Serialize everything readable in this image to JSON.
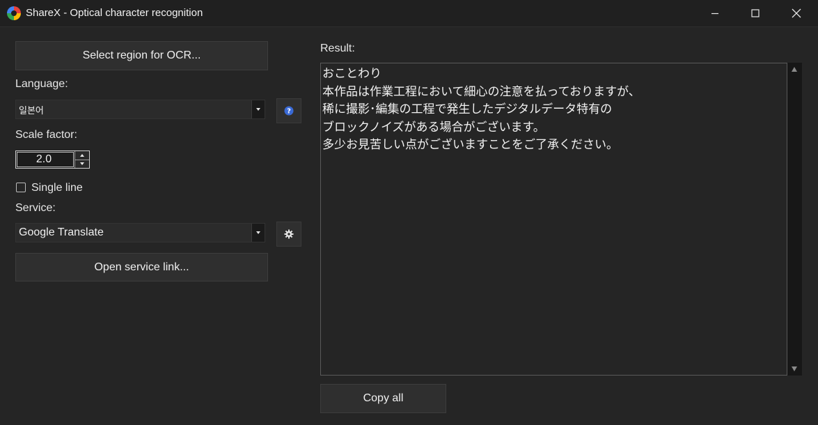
{
  "window": {
    "title": "ShareX - Optical character recognition",
    "icons": {
      "app": "sharex-logo-icon",
      "minimize": "minimize-icon",
      "maximize": "maximize-icon",
      "close": "close-icon"
    }
  },
  "left_panel": {
    "select_region_label": "Select region for OCR...",
    "language_label": "Language:",
    "language_value": "일본어",
    "language_help_icon": "help-icon",
    "scale_label": "Scale factor:",
    "scale_value": "2.0",
    "single_line_label": "Single line",
    "single_line_checked": false,
    "service_label": "Service:",
    "service_value": "Google Translate",
    "service_settings_icon": "gear-icon",
    "open_service_label": "Open service link..."
  },
  "right_panel": {
    "result_label": "Result:",
    "result_text": "おことわり\n本作品は作業工程において細心の注意を払っておりますが、\n稀に撮影･編集の工程で発生したデジタルデータ特有の\nブロックノイズがある場合がございます。\n多少お見苦しい点がございますことをご了承ください。",
    "copy_all_label": "Copy all"
  },
  "colors": {
    "background": "#252525",
    "titlebar": "#202020",
    "button": "#2f2f2f",
    "text": "#e6e6e6",
    "help_icon": "#3a6ad6"
  }
}
